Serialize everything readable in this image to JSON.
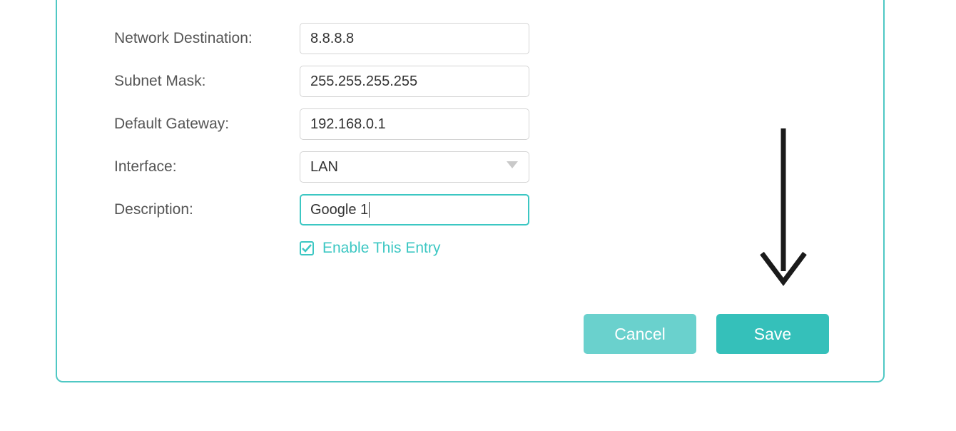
{
  "form": {
    "network_destination": {
      "label": "Network Destination:",
      "value": "8.8.8.8"
    },
    "subnet_mask": {
      "label": "Subnet Mask:",
      "value": "255.255.255.255"
    },
    "default_gateway": {
      "label": "Default Gateway:",
      "value": "192.168.0.1"
    },
    "interface": {
      "label": "Interface:",
      "selected": "LAN"
    },
    "description": {
      "label": "Description:",
      "value": "Google 1"
    },
    "enable_entry": {
      "label": "Enable This Entry",
      "checked": true
    }
  },
  "buttons": {
    "cancel": "Cancel",
    "save": "Save"
  },
  "colors": {
    "accent": "#3cc7c3"
  }
}
